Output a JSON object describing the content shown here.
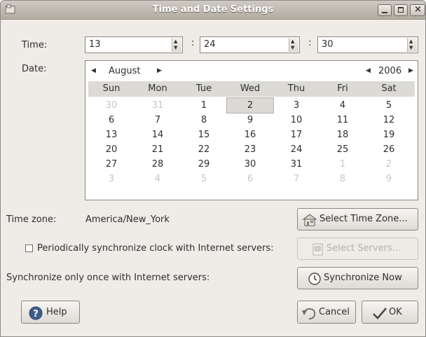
{
  "window": {
    "title": "Time and Date Settings"
  },
  "time": {
    "label": "Time:",
    "hours": "13",
    "minutes": "24",
    "seconds": "30",
    "separator": ":"
  },
  "date": {
    "label": "Date:",
    "month": "August",
    "year": "2006",
    "weekdays": [
      "Sun",
      "Mon",
      "Tue",
      "Wed",
      "Thu",
      "Fri",
      "Sat"
    ],
    "weeks": [
      [
        "30",
        "31",
        "1",
        "2",
        "3",
        "4",
        "5"
      ],
      [
        "6",
        "7",
        "8",
        "9",
        "10",
        "11",
        "12"
      ],
      [
        "13",
        "14",
        "15",
        "16",
        "17",
        "18",
        "19"
      ],
      [
        "20",
        "21",
        "22",
        "23",
        "24",
        "25",
        "26"
      ],
      [
        "27",
        "28",
        "29",
        "30",
        "31",
        "1",
        "2"
      ],
      [
        "3",
        "4",
        "5",
        "6",
        "7",
        "8",
        "9"
      ]
    ],
    "selected_day": "2"
  },
  "timezone": {
    "label": "Time zone:",
    "value": "America/New_York",
    "select_button": "Select Time Zone..."
  },
  "sync": {
    "periodic_label": "Periodically synchronize clock with Internet servers:",
    "periodic_checked": false,
    "select_servers_button": "Select Servers...",
    "once_label": "Synchronize only once with Internet servers:",
    "sync_now_button": "Synchronize Now"
  },
  "buttons": {
    "help": "Help",
    "cancel": "Cancel",
    "ok": "OK"
  },
  "colors": {
    "window_bg": "#efebe7",
    "titlebar": "#b2aca2",
    "selected_day_bg": "#dcdad5"
  }
}
